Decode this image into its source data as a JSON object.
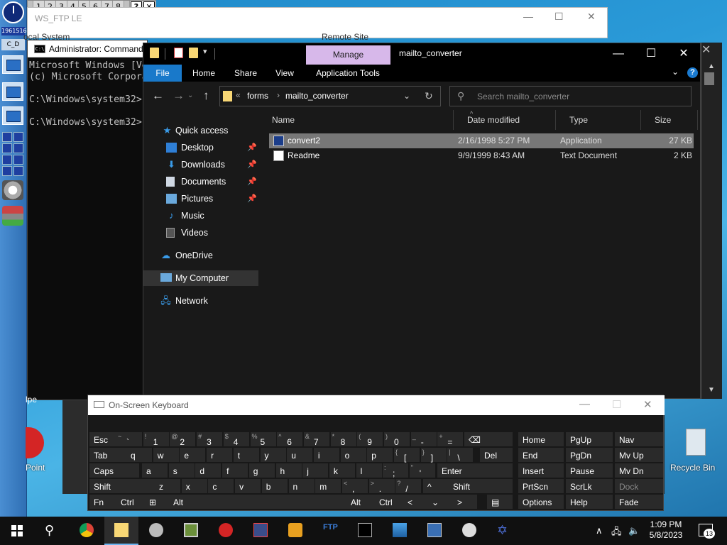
{
  "numbar": {
    "items": [
      "1",
      "2",
      "3",
      "4",
      "5",
      "6",
      "7",
      "8"
    ],
    "help": "?",
    "close": "✕"
  },
  "leftdock": {
    "counter": "1961516",
    "cd_label": "C_D"
  },
  "wsftp": {
    "title": "WS_FTP LE",
    "local": "ocal System",
    "remote": "Remote Site"
  },
  "cmd": {
    "title": "Administrator: Command Prompt",
    "lines": [
      "Microsoft Windows [Version",
      "(c) Microsoft Corporation",
      "",
      "C:\\Windows\\system32>",
      "",
      "C:\\Windows\\system32>"
    ]
  },
  "explorer": {
    "manage_tab": "Manage",
    "title": "mailto_converter",
    "ribbon_tabs": [
      "File",
      "Home",
      "Share",
      "View",
      "Application Tools"
    ],
    "address": {
      "crumbs": [
        "forms",
        "mailto_converter"
      ]
    },
    "search_placeholder": "Search mailto_converter",
    "nav": {
      "quick_access": "Quick access",
      "items": [
        "Desktop",
        "Downloads",
        "Documents",
        "Pictures",
        "Music",
        "Videos"
      ],
      "onedrive": "OneDrive",
      "my_computer": "My Computer",
      "network": "Network"
    },
    "columns": [
      "Name",
      "Date modified",
      "Type",
      "Size"
    ],
    "files": [
      {
        "name": "convert2",
        "date": "2/16/1998 5:27 PM",
        "type": "Application",
        "size": "27 KB"
      },
      {
        "name": "Readme",
        "date": "9/9/1999 8:43 AM",
        "type": "Text Document",
        "size": "2 KB"
      }
    ]
  },
  "desktop": {
    "point_label": "Point",
    "recycle_label": "Recycle Bin",
    "lpe_label": "lpe"
  },
  "osk": {
    "title": "On-Screen Keyboard",
    "row1": {
      "esc": "Esc",
      "backspace": "⌫"
    },
    "row2": {
      "tab": "Tab",
      "del": "Del"
    },
    "row3": {
      "caps": "Caps",
      "enter": "Enter"
    },
    "row4": {
      "shift_l": "Shift",
      "shift_r": "Shift"
    },
    "row5": {
      "fn": "Fn",
      "ctrl_l": "Ctrl",
      "alt_l": "Alt",
      "alt_r": "Alt",
      "ctrl_r": "Ctrl"
    },
    "nav_keys": [
      "Home",
      "PgUp",
      "Nav",
      "End",
      "PgDn",
      "Mv Up",
      "Insert",
      "Pause",
      "Mv Dn",
      "PrtScn",
      "ScrLk",
      "Dock",
      "Options",
      "Help",
      "Fade"
    ],
    "letters_q": [
      "q",
      "w",
      "e",
      "r",
      "t",
      "y",
      "u",
      "i",
      "o",
      "p"
    ],
    "letters_a": [
      "a",
      "s",
      "d",
      "f",
      "g",
      "h",
      "j",
      "k",
      "l"
    ],
    "letters_z": [
      "z",
      "x",
      "c",
      "v",
      "b",
      "n",
      "m"
    ]
  },
  "taskbar": {
    "time": "1:09 PM",
    "date": "5/8/2023",
    "notifications": "13"
  }
}
